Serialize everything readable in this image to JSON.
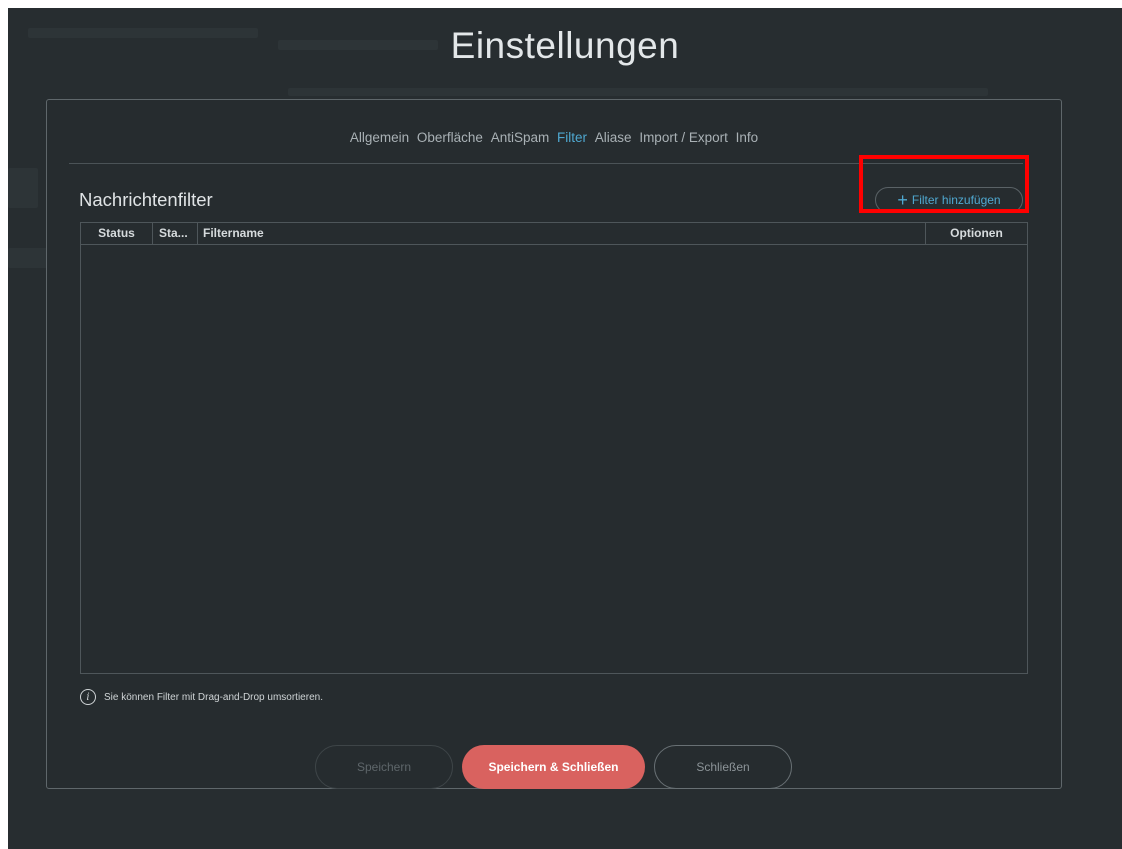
{
  "page": {
    "title": "Einstellungen"
  },
  "tabs": [
    {
      "label": "Allgemein",
      "active": false
    },
    {
      "label": "Oberfläche",
      "active": false
    },
    {
      "label": "AntiSpam",
      "active": false
    },
    {
      "label": "Filter",
      "active": true
    },
    {
      "label": "Aliase",
      "active": false
    },
    {
      "label": "Import / Export",
      "active": false
    },
    {
      "label": "Info",
      "active": false
    }
  ],
  "section": {
    "title": "Nachrichtenfilter",
    "add_button": {
      "icon": "plus-icon",
      "label": "Filter hinzufügen"
    }
  },
  "table": {
    "columns": [
      "Status",
      "Sta...",
      "Filtername",
      "Optionen"
    ],
    "rows": []
  },
  "hint": {
    "icon": "info-icon",
    "text": "Sie können Filter mit Drag-and-Drop umsortieren."
  },
  "footer": {
    "save_label": "Speichern",
    "save_close_label": "Speichern & Schließen",
    "close_label": "Schließen"
  },
  "colors": {
    "background": "#272d30",
    "accent": "#4fa8d0",
    "primary_button": "#d9625f",
    "highlight": "#ff0000"
  }
}
